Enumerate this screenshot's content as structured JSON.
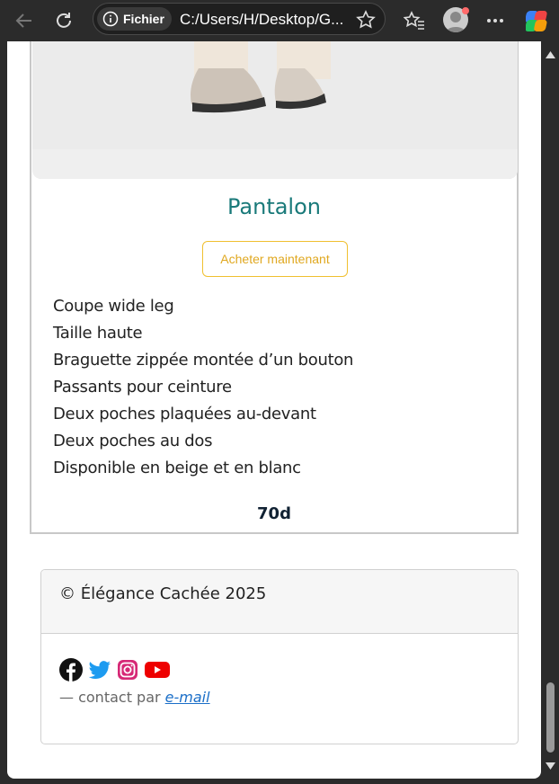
{
  "browser": {
    "info_label": "Fichier",
    "url": "C:/Users/H/Desktop/G...",
    "icons": [
      "back-icon",
      "refresh-icon",
      "info-icon",
      "favorite-star-icon",
      "favorites-icon",
      "profile-avatar",
      "more-icon",
      "copilot-icon"
    ]
  },
  "product": {
    "title": "Pantalon",
    "buy_label": "Acheter maintenant",
    "features": [
      "Coupe wide leg",
      "Taille haute",
      "Braguette zippée montée d’un bouton",
      "Passants pour ceinture",
      "Deux poches plaquées au-devant",
      "Deux poches au dos",
      "Disponible en beige et en blanc"
    ],
    "price": "70d"
  },
  "footer": {
    "copyright": "© Élégance Cachée 2025",
    "socials": [
      "facebook-icon",
      "twitter-icon",
      "instagram-icon",
      "youtube-icon"
    ],
    "contact_prefix": "— contact par ",
    "contact_link": "e-mail"
  },
  "colors": {
    "title": "#1a7a7a",
    "button_border": "#f0c030",
    "link": "#1a6ec8"
  }
}
